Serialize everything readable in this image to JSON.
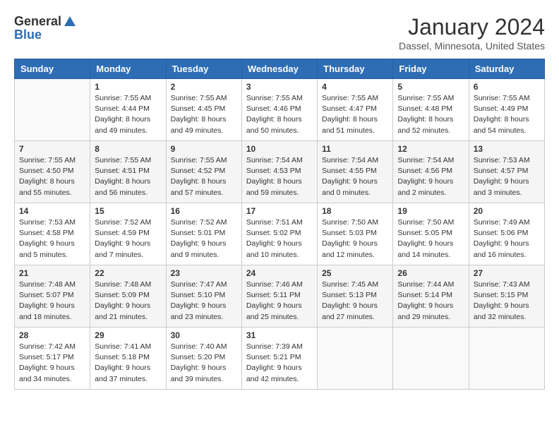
{
  "header": {
    "logo_general": "General",
    "logo_blue": "Blue",
    "title": "January 2024",
    "subtitle": "Dassel, Minnesota, United States"
  },
  "weekdays": [
    "Sunday",
    "Monday",
    "Tuesday",
    "Wednesday",
    "Thursday",
    "Friday",
    "Saturday"
  ],
  "weeks": [
    [
      {
        "day": null
      },
      {
        "day": "1",
        "sunrise": "Sunrise: 7:55 AM",
        "sunset": "Sunset: 4:44 PM",
        "daylight": "Daylight: 8 hours and 49 minutes."
      },
      {
        "day": "2",
        "sunrise": "Sunrise: 7:55 AM",
        "sunset": "Sunset: 4:45 PM",
        "daylight": "Daylight: 8 hours and 49 minutes."
      },
      {
        "day": "3",
        "sunrise": "Sunrise: 7:55 AM",
        "sunset": "Sunset: 4:46 PM",
        "daylight": "Daylight: 8 hours and 50 minutes."
      },
      {
        "day": "4",
        "sunrise": "Sunrise: 7:55 AM",
        "sunset": "Sunset: 4:47 PM",
        "daylight": "Daylight: 8 hours and 51 minutes."
      },
      {
        "day": "5",
        "sunrise": "Sunrise: 7:55 AM",
        "sunset": "Sunset: 4:48 PM",
        "daylight": "Daylight: 8 hours and 52 minutes."
      },
      {
        "day": "6",
        "sunrise": "Sunrise: 7:55 AM",
        "sunset": "Sunset: 4:49 PM",
        "daylight": "Daylight: 8 hours and 54 minutes."
      }
    ],
    [
      {
        "day": "7",
        "sunrise": "Sunrise: 7:55 AM",
        "sunset": "Sunset: 4:50 PM",
        "daylight": "Daylight: 8 hours and 55 minutes."
      },
      {
        "day": "8",
        "sunrise": "Sunrise: 7:55 AM",
        "sunset": "Sunset: 4:51 PM",
        "daylight": "Daylight: 8 hours and 56 minutes."
      },
      {
        "day": "9",
        "sunrise": "Sunrise: 7:55 AM",
        "sunset": "Sunset: 4:52 PM",
        "daylight": "Daylight: 8 hours and 57 minutes."
      },
      {
        "day": "10",
        "sunrise": "Sunrise: 7:54 AM",
        "sunset": "Sunset: 4:53 PM",
        "daylight": "Daylight: 8 hours and 59 minutes."
      },
      {
        "day": "11",
        "sunrise": "Sunrise: 7:54 AM",
        "sunset": "Sunset: 4:55 PM",
        "daylight": "Daylight: 9 hours and 0 minutes."
      },
      {
        "day": "12",
        "sunrise": "Sunrise: 7:54 AM",
        "sunset": "Sunset: 4:56 PM",
        "daylight": "Daylight: 9 hours and 2 minutes."
      },
      {
        "day": "13",
        "sunrise": "Sunrise: 7:53 AM",
        "sunset": "Sunset: 4:57 PM",
        "daylight": "Daylight: 9 hours and 3 minutes."
      }
    ],
    [
      {
        "day": "14",
        "sunrise": "Sunrise: 7:53 AM",
        "sunset": "Sunset: 4:58 PM",
        "daylight": "Daylight: 9 hours and 5 minutes."
      },
      {
        "day": "15",
        "sunrise": "Sunrise: 7:52 AM",
        "sunset": "Sunset: 4:59 PM",
        "daylight": "Daylight: 9 hours and 7 minutes."
      },
      {
        "day": "16",
        "sunrise": "Sunrise: 7:52 AM",
        "sunset": "Sunset: 5:01 PM",
        "daylight": "Daylight: 9 hours and 9 minutes."
      },
      {
        "day": "17",
        "sunrise": "Sunrise: 7:51 AM",
        "sunset": "Sunset: 5:02 PM",
        "daylight": "Daylight: 9 hours and 10 minutes."
      },
      {
        "day": "18",
        "sunrise": "Sunrise: 7:50 AM",
        "sunset": "Sunset: 5:03 PM",
        "daylight": "Daylight: 9 hours and 12 minutes."
      },
      {
        "day": "19",
        "sunrise": "Sunrise: 7:50 AM",
        "sunset": "Sunset: 5:05 PM",
        "daylight": "Daylight: 9 hours and 14 minutes."
      },
      {
        "day": "20",
        "sunrise": "Sunrise: 7:49 AM",
        "sunset": "Sunset: 5:06 PM",
        "daylight": "Daylight: 9 hours and 16 minutes."
      }
    ],
    [
      {
        "day": "21",
        "sunrise": "Sunrise: 7:48 AM",
        "sunset": "Sunset: 5:07 PM",
        "daylight": "Daylight: 9 hours and 18 minutes."
      },
      {
        "day": "22",
        "sunrise": "Sunrise: 7:48 AM",
        "sunset": "Sunset: 5:09 PM",
        "daylight": "Daylight: 9 hours and 21 minutes."
      },
      {
        "day": "23",
        "sunrise": "Sunrise: 7:47 AM",
        "sunset": "Sunset: 5:10 PM",
        "daylight": "Daylight: 9 hours and 23 minutes."
      },
      {
        "day": "24",
        "sunrise": "Sunrise: 7:46 AM",
        "sunset": "Sunset: 5:11 PM",
        "daylight": "Daylight: 9 hours and 25 minutes."
      },
      {
        "day": "25",
        "sunrise": "Sunrise: 7:45 AM",
        "sunset": "Sunset: 5:13 PM",
        "daylight": "Daylight: 9 hours and 27 minutes."
      },
      {
        "day": "26",
        "sunrise": "Sunrise: 7:44 AM",
        "sunset": "Sunset: 5:14 PM",
        "daylight": "Daylight: 9 hours and 29 minutes."
      },
      {
        "day": "27",
        "sunrise": "Sunrise: 7:43 AM",
        "sunset": "Sunset: 5:15 PM",
        "daylight": "Daylight: 9 hours and 32 minutes."
      }
    ],
    [
      {
        "day": "28",
        "sunrise": "Sunrise: 7:42 AM",
        "sunset": "Sunset: 5:17 PM",
        "daylight": "Daylight: 9 hours and 34 minutes."
      },
      {
        "day": "29",
        "sunrise": "Sunrise: 7:41 AM",
        "sunset": "Sunset: 5:18 PM",
        "daylight": "Daylight: 9 hours and 37 minutes."
      },
      {
        "day": "30",
        "sunrise": "Sunrise: 7:40 AM",
        "sunset": "Sunset: 5:20 PM",
        "daylight": "Daylight: 9 hours and 39 minutes."
      },
      {
        "day": "31",
        "sunrise": "Sunrise: 7:39 AM",
        "sunset": "Sunset: 5:21 PM",
        "daylight": "Daylight: 9 hours and 42 minutes."
      },
      {
        "day": null
      },
      {
        "day": null
      },
      {
        "day": null
      }
    ]
  ]
}
